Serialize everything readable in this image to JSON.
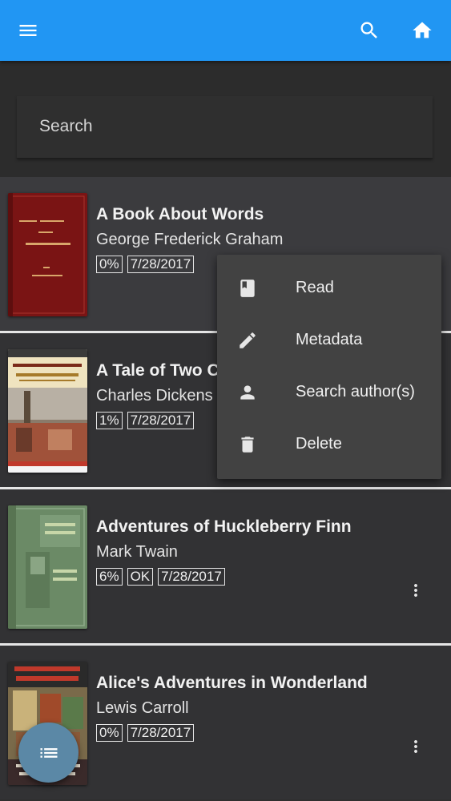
{
  "appbar": {
    "menu_icon": "menu-icon",
    "search_icon": "search-icon",
    "home_icon": "home-icon",
    "color": "#2196f3"
  },
  "search": {
    "placeholder": "Search"
  },
  "books": [
    {
      "title": "A Book About Words",
      "author": "George Frederick Graham",
      "badges": [
        "0%",
        "7/28/2017"
      ],
      "cover_color": "#7a1414"
    },
    {
      "title": "A Tale of Two C",
      "author": "Charles Dickens",
      "badges": [
        "1%",
        "7/28/2017"
      ],
      "cover_color": "#e8d9a8"
    },
    {
      "title": "Adventures of Huckleberry Finn",
      "author": "Mark Twain",
      "badges": [
        "6%",
        "OK",
        "7/28/2017"
      ],
      "cover_color": "#6b8a66"
    },
    {
      "title": "Alice's Adventures in Wonderland",
      "author": "Lewis Carroll",
      "badges": [
        "0%",
        "7/28/2017"
      ],
      "cover_color": "#8a2a1e"
    }
  ],
  "context_menu": {
    "items": [
      {
        "label": "Read",
        "icon": "book-icon"
      },
      {
        "label": "Metadata",
        "icon": "pencil-icon"
      },
      {
        "label": "Search author(s)",
        "icon": "person-icon"
      },
      {
        "label": "Delete",
        "icon": "trash-icon"
      }
    ]
  },
  "fab": {
    "icon": "list-icon",
    "color": "#5b88a6"
  }
}
